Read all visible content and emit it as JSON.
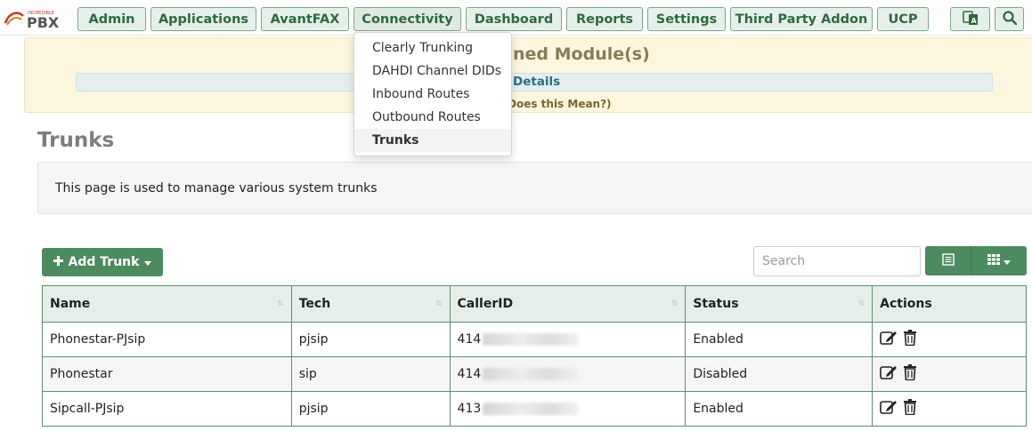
{
  "logo": {
    "brand_small": "INCREDIBLE",
    "brand_big": "PBX"
  },
  "nav": {
    "items": [
      "Admin",
      "Applications",
      "AvantFAX",
      "Connectivity",
      "Dashboard",
      "Reports",
      "Settings",
      "Third Party Addon",
      "UCP"
    ],
    "icons": [
      "language-icon",
      "search-icon"
    ],
    "active": "Connectivity"
  },
  "dropdown": {
    "items": [
      "Clearly Trunking",
      "DAHDI Channel DIDs",
      "Inbound Routes",
      "Outbound Routes",
      "Trunks"
    ],
    "active": "Trunks"
  },
  "banner": {
    "title_fragment": "ned Module(s)",
    "details_fragment": "Details",
    "mean_fragment": "Does this Mean?)"
  },
  "page": {
    "title": "Trunks",
    "description": "This page is used to manage various system trunks"
  },
  "toolbar": {
    "add_label": "Add Trunk",
    "search_placeholder": "Search"
  },
  "table": {
    "headers": [
      "Name",
      "Tech",
      "CallerID",
      "Status",
      "Actions"
    ],
    "rows": [
      {
        "name": "Phonestar-PJsip",
        "tech": "pjsip",
        "callerid": "414",
        "status": "Enabled"
      },
      {
        "name": "Phonestar",
        "tech": "sip",
        "callerid": "414",
        "status": "Disabled"
      },
      {
        "name": "Sipcall-PJsip",
        "tech": "pjsip",
        "callerid": "413",
        "status": "Enabled"
      }
    ]
  },
  "colors": {
    "accent": "#4c8b5f",
    "nav_text": "#2d6a3f",
    "banner_bg": "#fcf6df"
  }
}
